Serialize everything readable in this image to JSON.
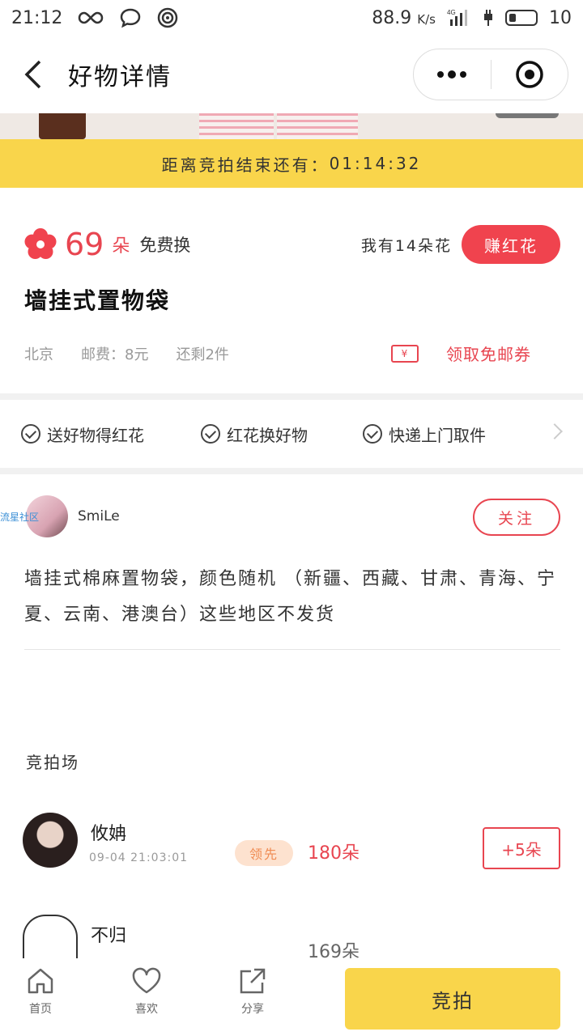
{
  "status_bar": {
    "time": "21:12",
    "network_speed": "88.9",
    "network_unit": "K/s",
    "network_type": "4G",
    "battery": "10"
  },
  "navbar": {
    "title": "好物详情",
    "back_icon": "chevron-left-icon",
    "more_icon": "more-dots-icon",
    "target_icon": "record-icon"
  },
  "countdown": {
    "label": "距离竞拍结束还有：",
    "time": "01:14:32"
  },
  "product": {
    "price": "69",
    "unit": "朵",
    "free_label": "免费换",
    "my_flowers": "我有14朵花",
    "earn_button": "赚红花",
    "title": "墙挂式置物袋",
    "location": "北京",
    "shipping": "邮费：8元",
    "stock": "还剩2件",
    "coupon_label": "领取免邮券",
    "coupon_icon_text": "¥",
    "accent_color": "#e84550"
  },
  "features": [
    {
      "label": "送好物得红花"
    },
    {
      "label": "红花换好物"
    },
    {
      "label": "快递上门取件"
    }
  ],
  "seller": {
    "badge": "流星社区",
    "name": "SmiLe",
    "follow_button": "关注"
  },
  "description": "墙挂式棉麻置物袋，颜色随机 （新疆、西藏、甘肃、青海、宁夏、云南、港澳台）这些地区不发货",
  "auction": {
    "title": "竞拍场",
    "bids": [
      {
        "name": "攸姌",
        "time": "09-04 21:03:01",
        "lead_badge": "领先",
        "amount": "180朵",
        "plus_button": "+5朵"
      },
      {
        "name": "不归",
        "time": "",
        "amount": "169朵"
      }
    ]
  },
  "tabbar": {
    "home": "首页",
    "like": "喜欢",
    "share": "分享",
    "bid_button": "竞拍"
  },
  "colors": {
    "yellow": "#f9d54b",
    "red": "#f0434e"
  }
}
